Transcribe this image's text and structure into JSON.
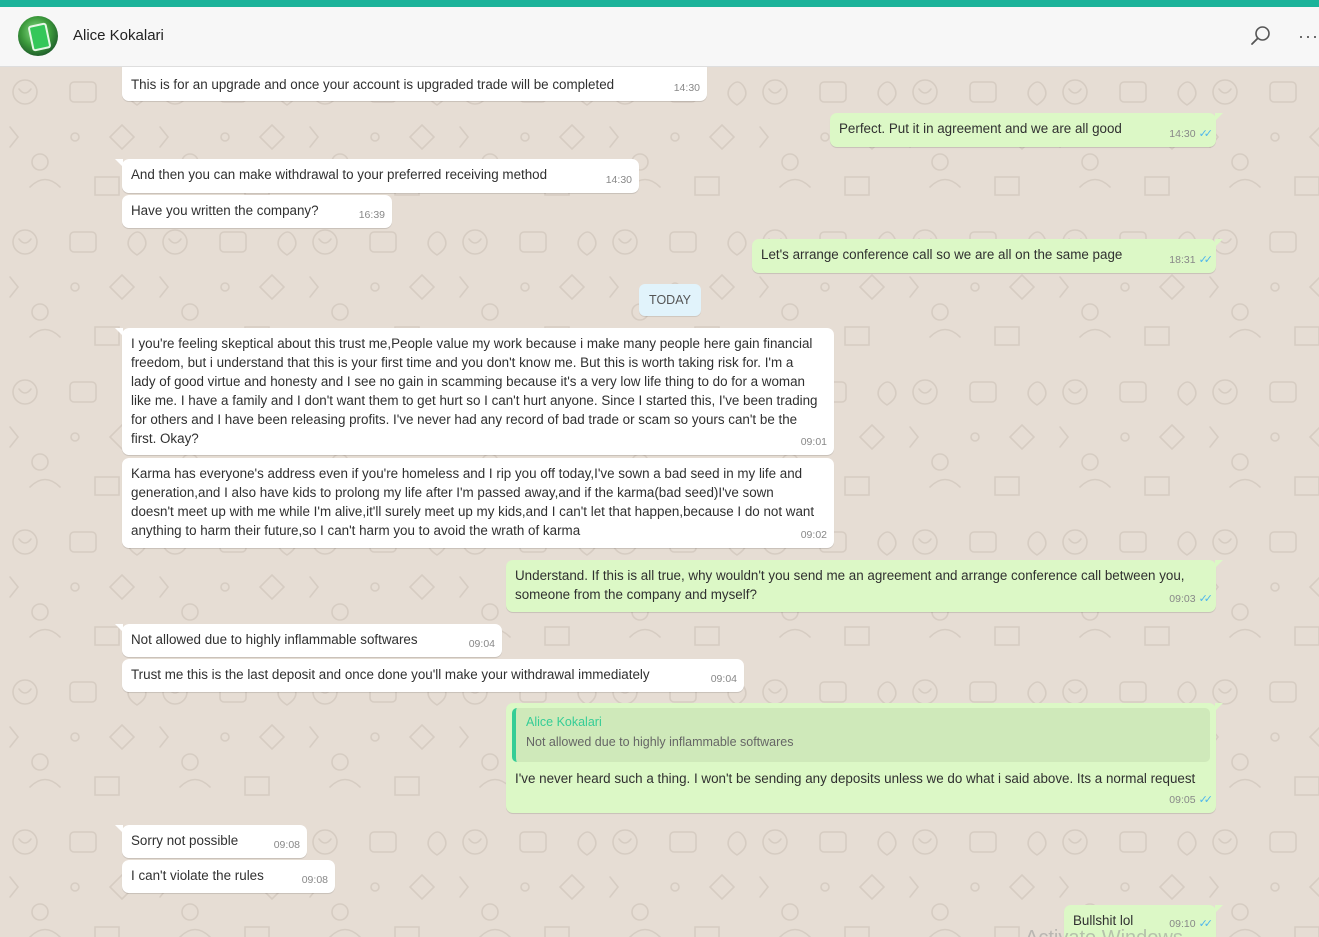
{
  "header": {
    "contact_name": "Alice Kokalari"
  },
  "date_divider": "TODAY",
  "quote": {
    "author": "Alice Kokalari",
    "text": "Not allowed due to highly inflammable softwares"
  },
  "watermark": "Activate Windows",
  "messages": [
    {
      "dir": "in",
      "text": "This is for an upgrade and once your account is upgraded trade will be completed",
      "time": "14:30"
    },
    {
      "dir": "out",
      "text": "Perfect. Put it in agreement and we are all good",
      "time": "14:30"
    },
    {
      "dir": "in",
      "text": "And then you can make withdrawal to your preferred receiving method",
      "time": "14:30"
    },
    {
      "dir": "in",
      "text": "Have you written the company?",
      "time": "16:39"
    },
    {
      "dir": "out",
      "text": "Let's arrange conference call so we are all on the same page",
      "time": "18:31"
    },
    {
      "dir": "in",
      "text": "I you're feeling skeptical about this trust me,People value my work because i make many people here gain financial freedom, but i understand that this is your first time and you don't know me. But this is worth taking risk for. I'm a lady of good virtue and honesty and I see no gain in scamming because it's a very low life thing to do for a woman like me. I have a family and I don't want them to get hurt so I can't hurt anyone. Since I started this, I've been trading for others and I have been releasing profits. I've never had any record of bad trade or scam so yours can't be the first. Okay?",
      "time": "09:01"
    },
    {
      "dir": "in",
      "text": "Karma has everyone's address even if you're homeless and I rip you off today,I've sown a bad seed in my life and generation,and I also have kids to prolong my life after I'm passed away,and if the karma(bad seed)I've sown doesn't meet up with me while I'm alive,it'll surely meet up my kids,and I can't let that happen,because I do not want anything to harm their future,so I can't harm you to avoid the wrath of karma",
      "time": "09:02"
    },
    {
      "dir": "out",
      "text": "Understand. If this is all true, why wouldn't you send me an agreement and arrange conference call between you, someone from the company and myself?",
      "time": "09:03"
    },
    {
      "dir": "in",
      "text": "Not allowed due to highly inflammable softwares",
      "time": "09:04"
    },
    {
      "dir": "in",
      "text": "Trust me this is the last deposit and once done you'll make your withdrawal immediately",
      "time": "09:04"
    },
    {
      "dir": "out",
      "text": "I've never heard such a thing. I won't be sending any deposits unless we do what i said above. Its a normal request",
      "time": "09:05"
    },
    {
      "dir": "in",
      "text": "Sorry not possible",
      "time": "09:08"
    },
    {
      "dir": "in",
      "text": "I can't violate the rules",
      "time": "09:08"
    },
    {
      "dir": "out",
      "text": "Bullshit lol",
      "time": "09:10"
    }
  ]
}
